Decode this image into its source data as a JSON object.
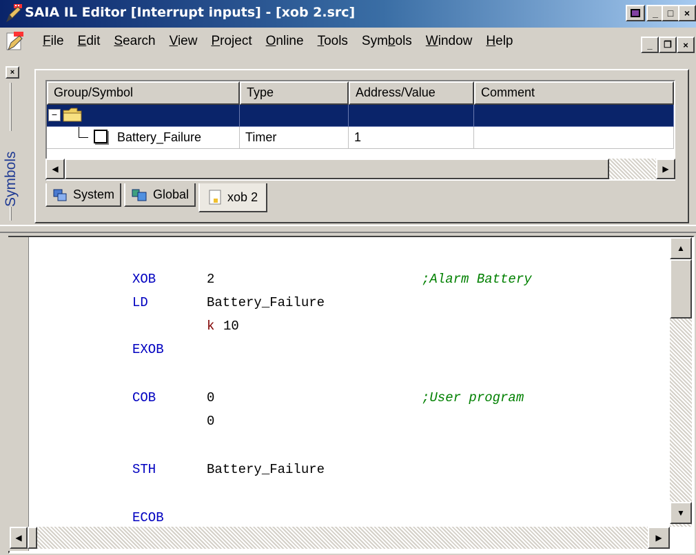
{
  "window": {
    "title": "SAIA IL Editor [Interrupt inputs] - [xob 2.src]",
    "controls": {
      "extra": "▣",
      "minimize": "_",
      "maximize": "□",
      "close": "×"
    }
  },
  "menu": {
    "items": [
      {
        "label": "File"
      },
      {
        "label": "Edit"
      },
      {
        "label": "Search"
      },
      {
        "label": "View"
      },
      {
        "label": "Project"
      },
      {
        "label": "Online"
      },
      {
        "label": "Tools"
      },
      {
        "label": "Symbols"
      },
      {
        "label": "Window"
      },
      {
        "label": "Help"
      }
    ],
    "doc_controls": {
      "minimize": "_",
      "restore": "❐",
      "close": "×"
    }
  },
  "symbols": {
    "pane_label": "Symbols",
    "close_label": "×",
    "columns": [
      "Group/Symbol",
      "Type",
      "Address/Value",
      "Comment"
    ],
    "rows": [
      {
        "name": "",
        "type": "",
        "address": "",
        "comment": "",
        "selected": true
      },
      {
        "name": "Battery_Failure",
        "type": "Timer",
        "address": "1",
        "comment": "",
        "selected": false
      }
    ],
    "tree_expander": "−",
    "tabs": [
      {
        "label": "System",
        "icon": "system-icon"
      },
      {
        "label": "Global",
        "icon": "global-icon"
      },
      {
        "label": "xob 2",
        "icon": "file-icon",
        "active": true
      }
    ]
  },
  "editor": {
    "lines": [
      {
        "kw": "XOB",
        "arg": "2",
        "comment": ";Alarm Battery"
      },
      {
        "kw": "LD",
        "arg": "Battery_Failure",
        "comment": ""
      },
      {
        "kw": "",
        "arg": "10",
        "prefix": "k",
        "comment": ""
      },
      {
        "kw": "EXOB",
        "arg": "",
        "comment": ""
      },
      {
        "kw": "COB",
        "arg": "0",
        "comment": ";User program"
      },
      {
        "kw": "",
        "arg": "0",
        "comment": ""
      },
      {
        "kw": "STH",
        "arg": "Battery_Failure",
        "comment": ""
      },
      {
        "kw": "ECOB",
        "arg": "",
        "comment": ""
      }
    ]
  },
  "colors": {
    "keyword": "#0000c0",
    "comment": "#008000",
    "constant_prefix": "#800000",
    "selection": "#0a246a"
  }
}
